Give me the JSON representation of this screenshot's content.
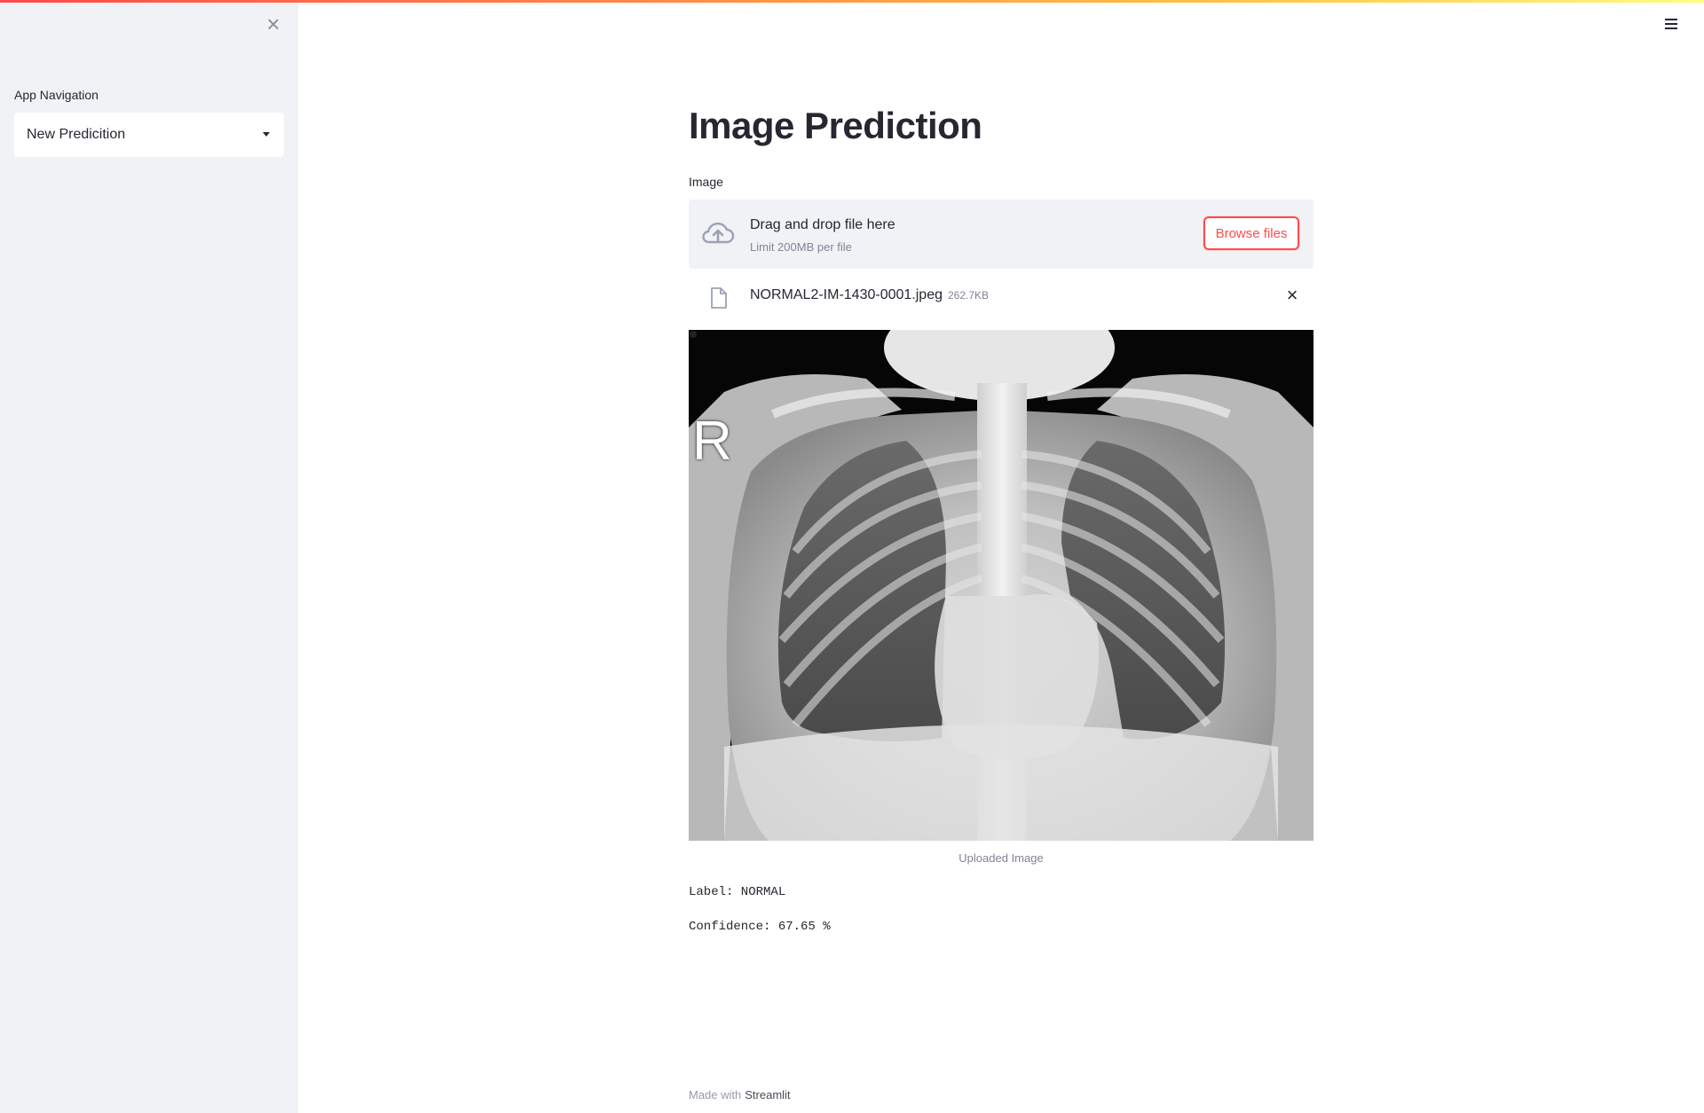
{
  "sidebar": {
    "close_icon": "close-icon",
    "nav_label": "App Navigation",
    "nav_selected": "New Predicition"
  },
  "header": {
    "menu_icon": "hamburger-menu-icon"
  },
  "main": {
    "title": "Image Prediction",
    "uploader": {
      "label": "Image",
      "dropzone_text": "Drag and drop file here",
      "limit_text": "Limit 200MB per file",
      "browse_label": "Browse files",
      "file_name": "NORMAL2-IM-1430-0001.jpeg",
      "file_size": "262.7KB"
    },
    "image": {
      "marker": "R",
      "caption": "Uploaded Image"
    },
    "result": {
      "label_line": "Label: NORMAL",
      "confidence_line": "Confidence: 67.65 %"
    }
  },
  "footer": {
    "made_with": "Made with",
    "brand": "Streamlit"
  },
  "colors": {
    "accent": "#ff4b4b",
    "sidebar_bg": "#f0f2f6",
    "text": "#262730"
  }
}
